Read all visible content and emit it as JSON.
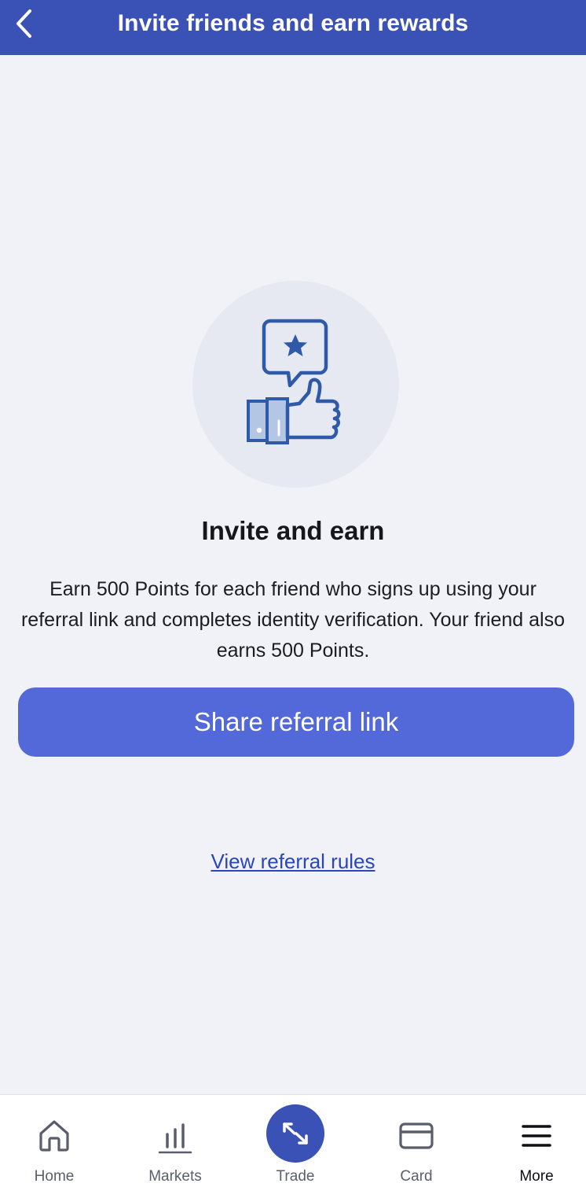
{
  "header": {
    "title": "Invite friends and earn rewards",
    "back_icon": "chevron-left-icon"
  },
  "hero": {
    "illustration": "thumbs-up-star-bubble-icon"
  },
  "content": {
    "title": "Invite and earn",
    "description": "Earn 500 Points for each friend who signs up using your referral link and completes identity verification. Your friend also earns 500 Points.",
    "share_button": "Share referral link",
    "rules_link": "View referral rules"
  },
  "tabbar": {
    "tabs": [
      {
        "label": "Home",
        "icon": "home-icon"
      },
      {
        "label": "Markets",
        "icon": "bar-chart-icon"
      },
      {
        "label": "Trade",
        "icon": "swap-arrows-icon"
      },
      {
        "label": "Card",
        "icon": "credit-card-icon"
      },
      {
        "label": "More",
        "icon": "menu-icon"
      }
    ],
    "active_tab": "More"
  },
  "colors": {
    "header_bg": "#3a51b5",
    "page_bg": "#f1f2f8",
    "button_bg": "#5469d9",
    "link": "#2b46b8",
    "icon_blue": "#2f5aa8",
    "icon_light": "#b3c6e4"
  }
}
